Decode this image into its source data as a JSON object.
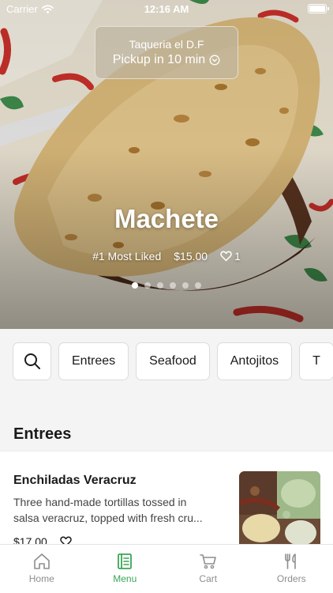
{
  "status_bar": {
    "carrier": "Carrier",
    "time": "12:16 AM"
  },
  "pickup": {
    "restaurant": "Taqueria el D.F",
    "label": "Pickup in 10 min"
  },
  "hero": {
    "title": "Machete",
    "rank": "#1 Most Liked",
    "price": "$15.00",
    "likes": "1",
    "slide_count": 6,
    "active_slide": 1
  },
  "categories": [
    {
      "label": "Entrees"
    },
    {
      "label": "Seafood"
    },
    {
      "label": "Antojitos"
    },
    {
      "label": "T"
    }
  ],
  "section": {
    "title": "Entrees"
  },
  "item": {
    "name": "Enchiladas Veracruz",
    "description_line1": "Three hand-made tortillas tossed in",
    "description_line2": "salsa veracruz, topped with fresh cru...",
    "price": "$17.00"
  },
  "tabs": [
    {
      "label": "Home",
      "icon": "home-icon"
    },
    {
      "label": "Menu",
      "icon": "menu-book-icon",
      "active": true
    },
    {
      "label": "Cart",
      "icon": "cart-icon"
    },
    {
      "label": "Orders",
      "icon": "utensils-icon"
    }
  ],
  "colors": {
    "accent": "#3aa655",
    "tab_inactive": "#8e8e8e"
  }
}
